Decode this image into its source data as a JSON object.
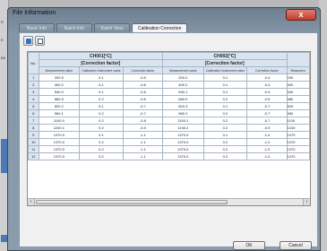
{
  "window": {
    "title": "File Information",
    "close_label": "x"
  },
  "tabs": [
    {
      "label": "Basic Info",
      "active": false
    },
    {
      "label": "Batch Info",
      "active": false
    },
    {
      "label": "Batch View",
      "active": false
    },
    {
      "label": "Calibration Correction",
      "active": true
    }
  ],
  "toolbar": {
    "icons": [
      "save-icon",
      "export-icon"
    ]
  },
  "background": {
    "left_labels": [
      "R",
      "E",
      "BK"
    ]
  },
  "table": {
    "no_header": "No.",
    "groups": [
      {
        "line1": "CH001[°C]",
        "line2": "[Correction factor]",
        "cols": [
          "Measurement value",
          "Calibration Instrument value",
          "Correction factor"
        ]
      },
      {
        "line1": "CH002[°C]",
        "line2": "[Correction factor]",
        "cols": [
          "Measurement value",
          "Calibration Instrument value",
          "Correction factor"
        ]
      }
    ],
    "extra_header": "Measurem",
    "rows": [
      [
        "1",
        "200.5",
        "0.1",
        "-0.5",
        "200.2",
        "0.1",
        "-0.4",
        "200"
      ],
      [
        "2",
        "400.2",
        "0.1",
        "-0.6",
        "400.2",
        "0.1",
        "-0.4",
        "400"
      ],
      [
        "3",
        "540.0",
        "0.1",
        "-0.6",
        "540.1",
        "0.1",
        "-0.4",
        "540"
      ],
      [
        "4",
        "680.5",
        "0.2",
        "-0.6",
        "680.5",
        "0.2",
        "-0.6",
        "680"
      ],
      [
        "5",
        "820.2",
        "0.1",
        "-0.7",
        "820.3",
        "0.1",
        "-0.7",
        "820"
      ],
      [
        "6",
        "960.1",
        "0.2",
        "-0.7",
        "960.2",
        "0.2",
        "-0.7",
        "960"
      ],
      [
        "7",
        "1100.0",
        "0.2",
        "-0.8",
        "1100.1",
        "0.2",
        "-0.7",
        "1100"
      ],
      [
        "8",
        "1240.1",
        "0.2",
        "-0.9",
        "1240.2",
        "0.2",
        "-0.9",
        "1240"
      ],
      [
        "9",
        "1370.0",
        "0.1",
        "-1.1",
        "1370.0",
        "0.1",
        "-1.0",
        "1370"
      ],
      [
        "10",
        "1370.0",
        "0.2",
        "-1.1",
        "1370.0",
        "0.2",
        "-1.0",
        "1370"
      ],
      [
        "11",
        "1370.0",
        "0.2",
        "-1.1",
        "1370.0",
        "0.2",
        "-1.0",
        "1370"
      ],
      [
        "12",
        "1370.0",
        "0.2",
        "-1.1",
        "1370.0",
        "0.2",
        "-1.0",
        "1370"
      ]
    ]
  },
  "footer": {
    "ok_label": "OK",
    "cancel_label": "Cancel"
  }
}
